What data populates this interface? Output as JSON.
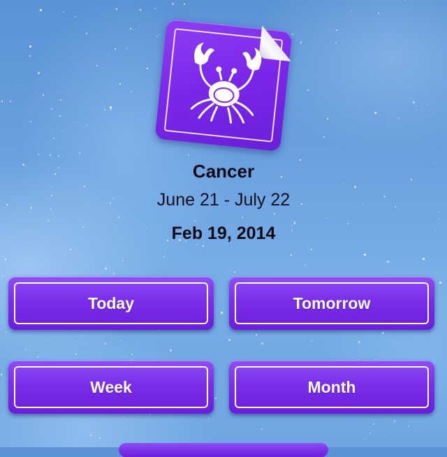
{
  "sign": {
    "name": "Cancer",
    "date_range": "June 21 - July 22",
    "icon": "cancer-crab-icon"
  },
  "current_date": "Feb 19, 2014",
  "buttons": {
    "today": "Today",
    "tomorrow": "Tomorrow",
    "week": "Week",
    "month": "Month"
  },
  "colors": {
    "accent": "#7a2ee8",
    "background": "#6aa0de"
  }
}
